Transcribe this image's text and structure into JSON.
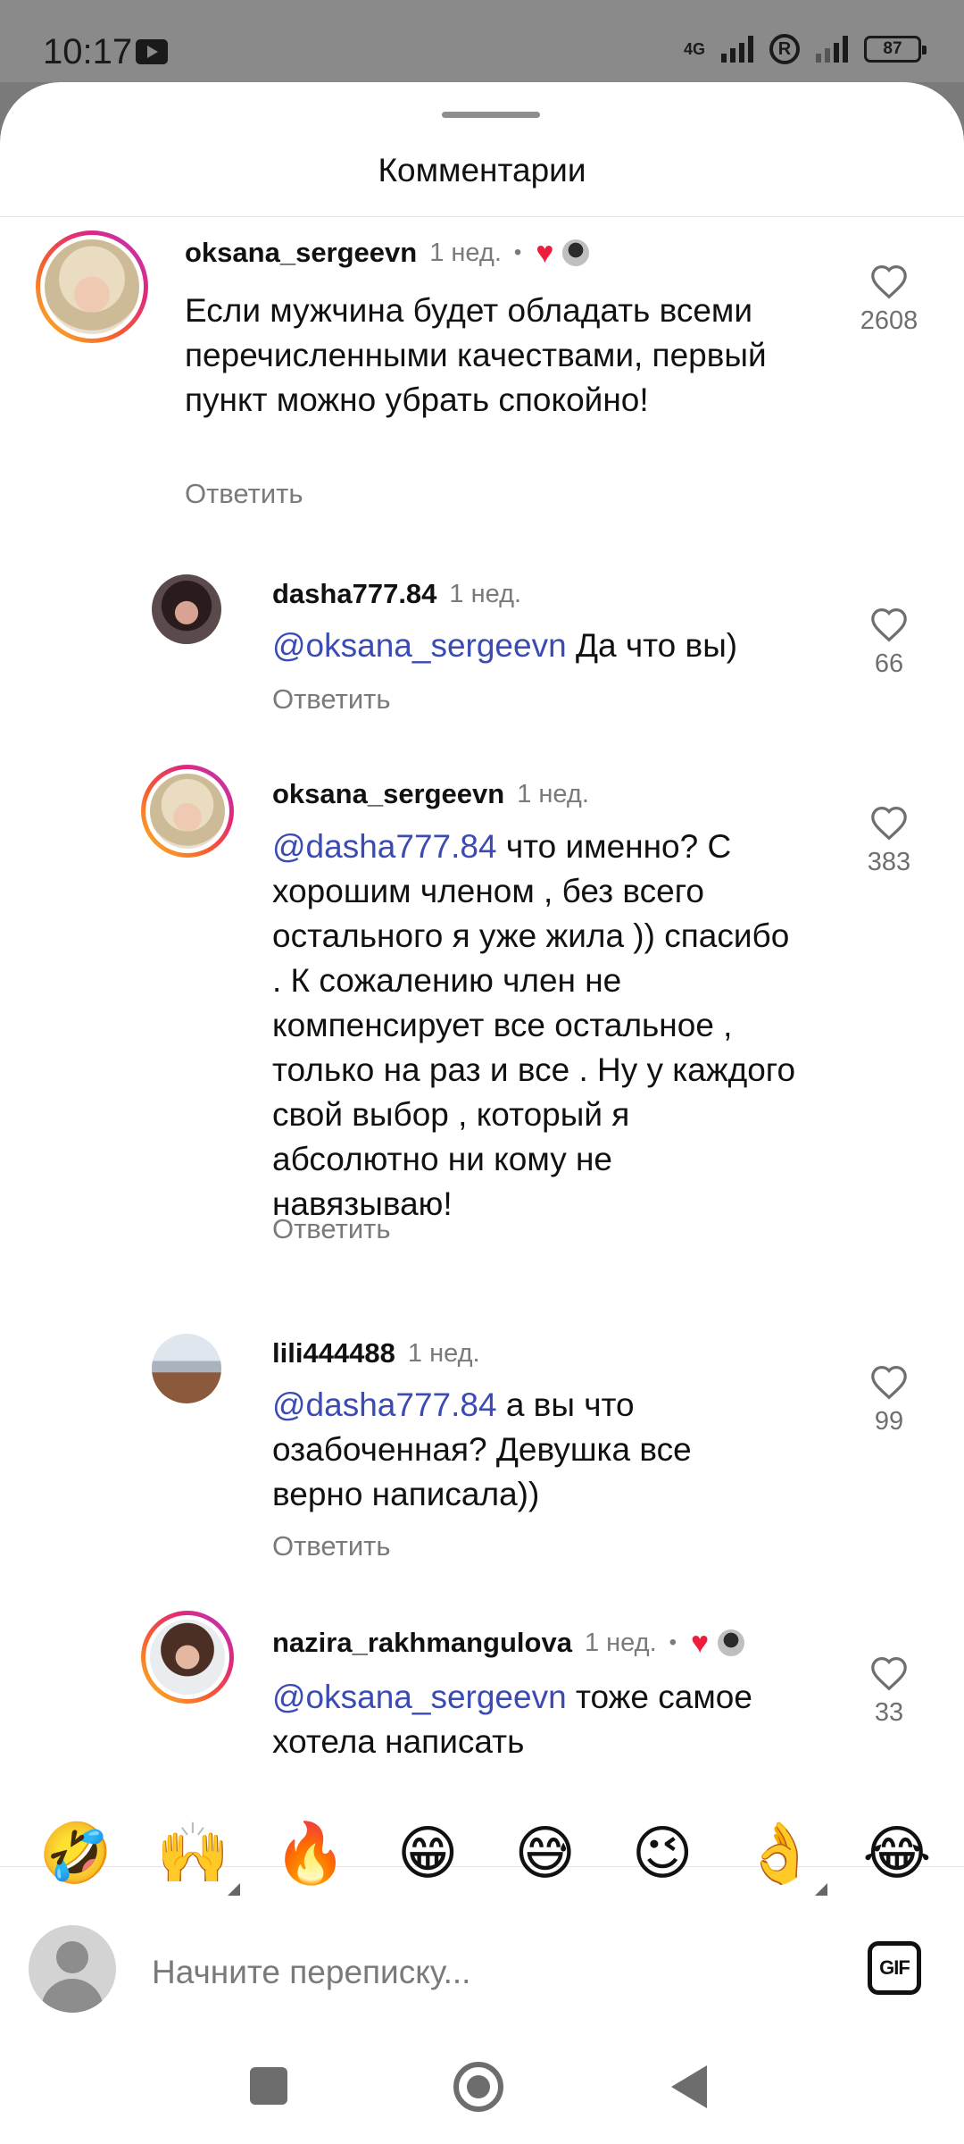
{
  "status_bar": {
    "time": "10:17",
    "network_label": "4G",
    "battery": "87",
    "icons": [
      "media-icon",
      "signal-icon",
      "roaming-r-icon",
      "battery-icon"
    ]
  },
  "sheet": {
    "title": "Комментарии"
  },
  "comments": [
    {
      "username": "oksana_sergeevn",
      "time": "1 нед.",
      "separator": "•",
      "liked_by_author": true,
      "text": "Если мужчина будет обладать всеми перечисленными качествами, первый пункт можно убрать спокойно!",
      "reply_label": "Ответить",
      "likes": "2608"
    },
    {
      "username": "dasha777.84",
      "time": "1 нед.",
      "mention": "@oksana_sergeevn",
      "text": " Да что вы)",
      "reply_label": "Ответить",
      "likes": "66"
    },
    {
      "username": "oksana_sergeevn",
      "time": "1 нед.",
      "mention": "@dasha777.84",
      "text": " что именно? С хорошим членом , без всего остального я уже жила )) спасибо . К сожалению член не компенсирует все остальное , только на раз и все . Ну у каждого свой выбор , который я абсолютно ни кому не навязываю!",
      "reply_label": "Ответить",
      "likes": "383"
    },
    {
      "username": "lili444488",
      "time": "1 нед.",
      "mention": "@dasha777.84",
      "text": " а вы что озабоченная? Девушка все верно написала))",
      "reply_label": "Ответить",
      "likes": "99"
    },
    {
      "username": "nazira_rakhmangulova",
      "time": "1 нед.",
      "separator": "•",
      "liked_by_author": true,
      "mention": "@oksana_sergeevn",
      "text": " тоже самое хотела написать",
      "likes": "33"
    }
  ],
  "emoji_bar": [
    "🤣",
    "🙌",
    "🔥",
    "😁",
    "😅",
    "😉",
    "👌",
    "😂"
  ],
  "composer": {
    "placeholder": "Начните переписку...",
    "gif_label": "GIF"
  },
  "colors": {
    "mention": "#3b4bb3",
    "like_badge": "#ee1d3c",
    "story_ring": [
      "#f9c223",
      "#f65c30",
      "#e0287b",
      "#b33bc8"
    ]
  }
}
